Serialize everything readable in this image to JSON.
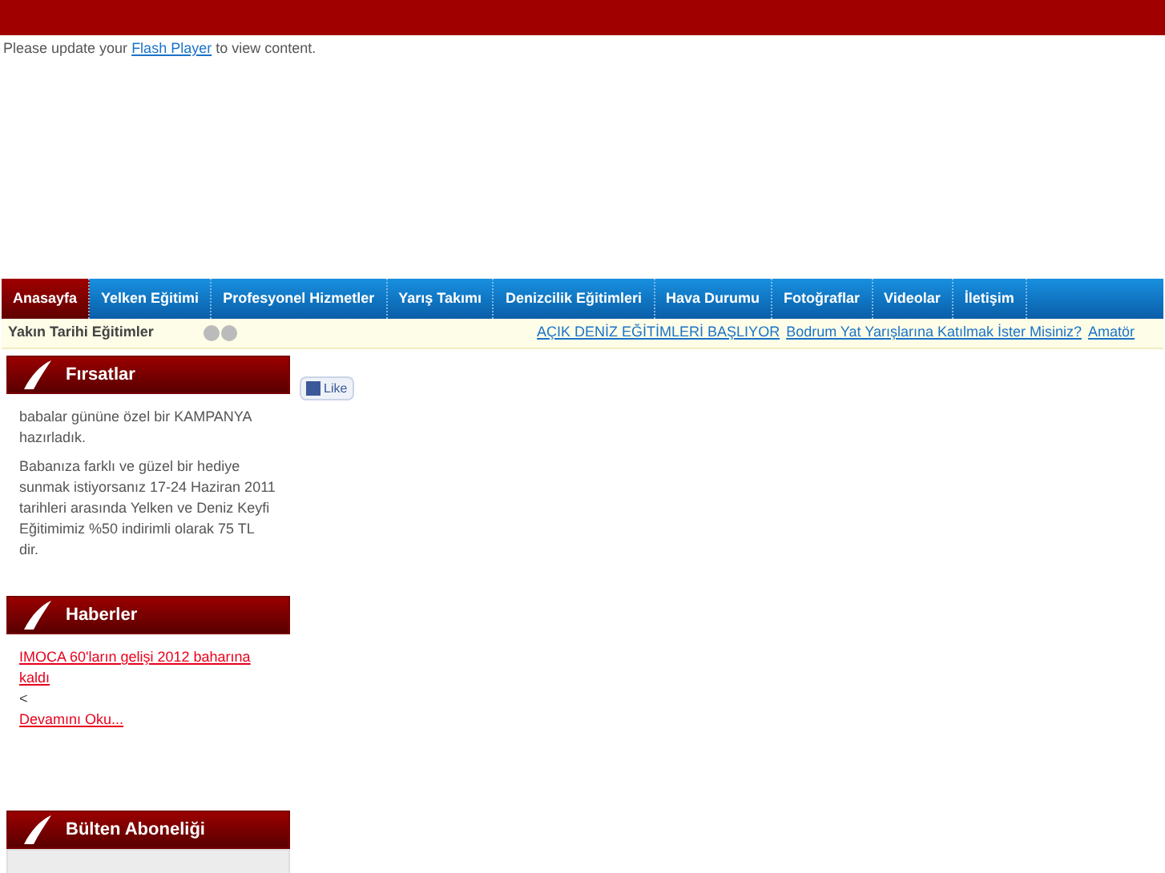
{
  "flash_notice": {
    "before": "Please update your ",
    "link": "Flash Player",
    "after": " to view content."
  },
  "nav": [
    {
      "label": "Anasayfa",
      "selected": true
    },
    {
      "label": "Yelken Eğitimi",
      "selected": false
    },
    {
      "label": "Profesyonel Hizmetler",
      "selected": false
    },
    {
      "label": "Yarış Takımı",
      "selected": false
    },
    {
      "label": "Denizcilik Eğitimleri",
      "selected": false
    },
    {
      "label": "Hava Durumu",
      "selected": false
    },
    {
      "label": "Fotoğraflar",
      "selected": false
    },
    {
      "label": "Videolar",
      "selected": false
    },
    {
      "label": "İletişim",
      "selected": false
    }
  ],
  "ticker": {
    "label": "Yakın Tarihi Eğitimler",
    "links": [
      "AÇIK DENİZ EĞİTİMLERİ BAŞLIYOR",
      "Bodrum Yat Yarışlarına Katılmak İster Misiniz?",
      "Amatör"
    ]
  },
  "firsatlar": {
    "title": "Fırsatlar",
    "paragraphs": [
      "babalar gününe özel bir KAMPANYA hazırladık.",
      "Babanıza farklı ve güzel bir hediye sunmak istiyorsanız 17-24 Haziran 2011 tarihleri arasında Yelken ve Deniz Keyfi Eğitimimiz %50 indirimli olarak 75 TL dir."
    ]
  },
  "haberler": {
    "title": "Haberler",
    "headline": "IMOCA 60'ların gelişi 2012 baharına kaldı",
    "separator": "<",
    "read_more": "Devamını Oku..."
  },
  "bulten": {
    "title": "Bülten Aboneliği"
  },
  "like_button": {
    "label": "Like"
  }
}
